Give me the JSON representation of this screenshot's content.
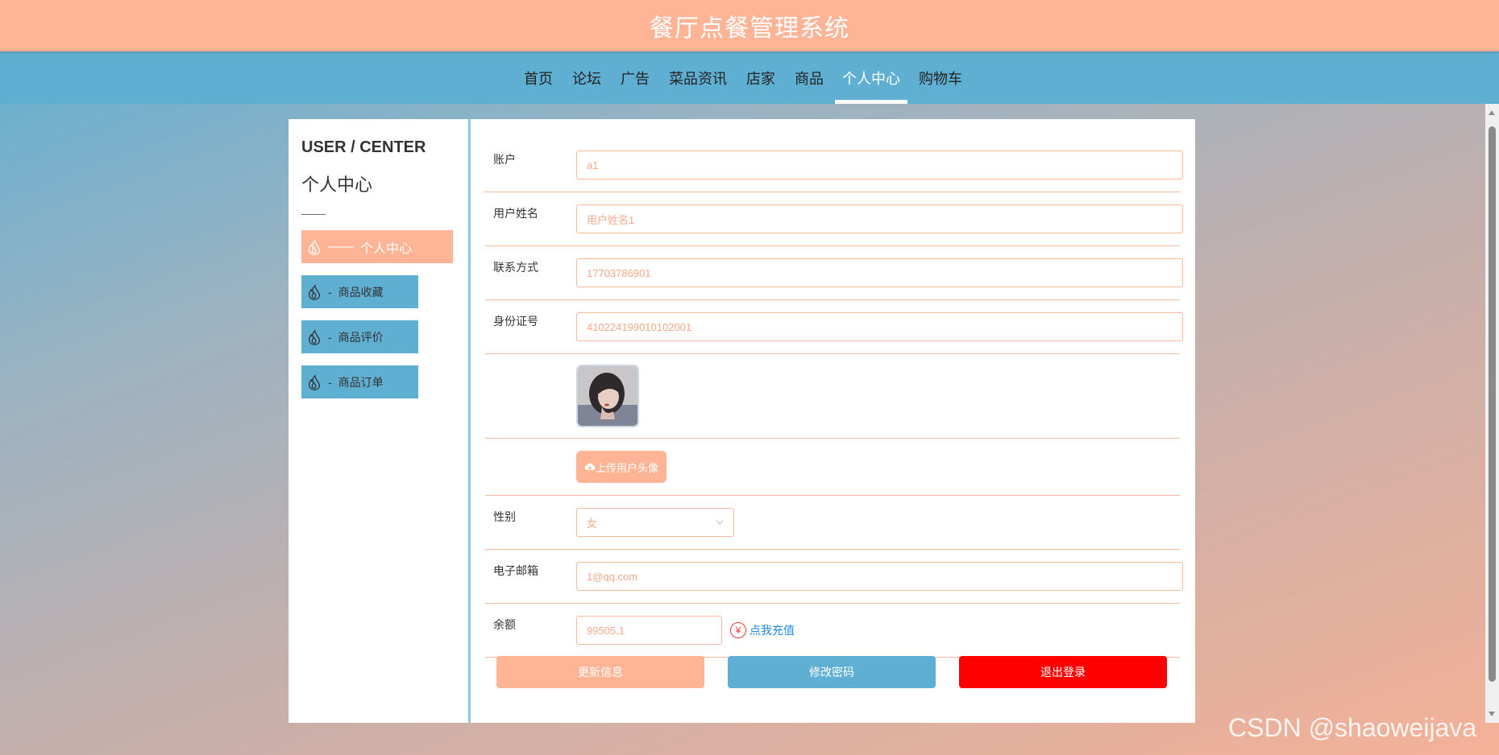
{
  "header": {
    "site_title": "餐厅点餐管理系统"
  },
  "nav": {
    "items": [
      {
        "label": "首页"
      },
      {
        "label": "论坛"
      },
      {
        "label": "广告"
      },
      {
        "label": "菜品资讯"
      },
      {
        "label": "店家"
      },
      {
        "label": "商品"
      },
      {
        "label": "个人中心",
        "active": true
      },
      {
        "label": "购物车"
      }
    ]
  },
  "sidebar": {
    "en_title": "USER / CENTER",
    "cn_title": "个人中心",
    "items": [
      {
        "label": "个人中心",
        "dash": "——",
        "active": true
      },
      {
        "label": "商品收藏",
        "dash": "-"
      },
      {
        "label": "商品评价",
        "dash": "-"
      },
      {
        "label": "商品订单",
        "dash": "-"
      }
    ]
  },
  "form": {
    "account": {
      "label": "账户",
      "value": "a1"
    },
    "username": {
      "label": "用户姓名",
      "value": "用户姓名1"
    },
    "contact": {
      "label": "联系方式",
      "value": "17703786901"
    },
    "id_number": {
      "label": "身份证号",
      "value": "410224199010102001"
    },
    "upload_button": "上传用户头像",
    "gender": {
      "label": "性别",
      "value": "女"
    },
    "email": {
      "label": "电子邮箱",
      "value": "1@qq.com"
    },
    "balance": {
      "label": "余额",
      "value": "99505.1"
    },
    "recharge_link": "点我充值"
  },
  "actions": {
    "update": "更新信息",
    "change_password": "修改密码",
    "logout": "退出登录"
  },
  "colors": {
    "accent_peach": "#ffb496",
    "accent_blue": "#5fafd2",
    "danger": "#ff0000"
  },
  "watermark": "CSDN @shaoweijava"
}
